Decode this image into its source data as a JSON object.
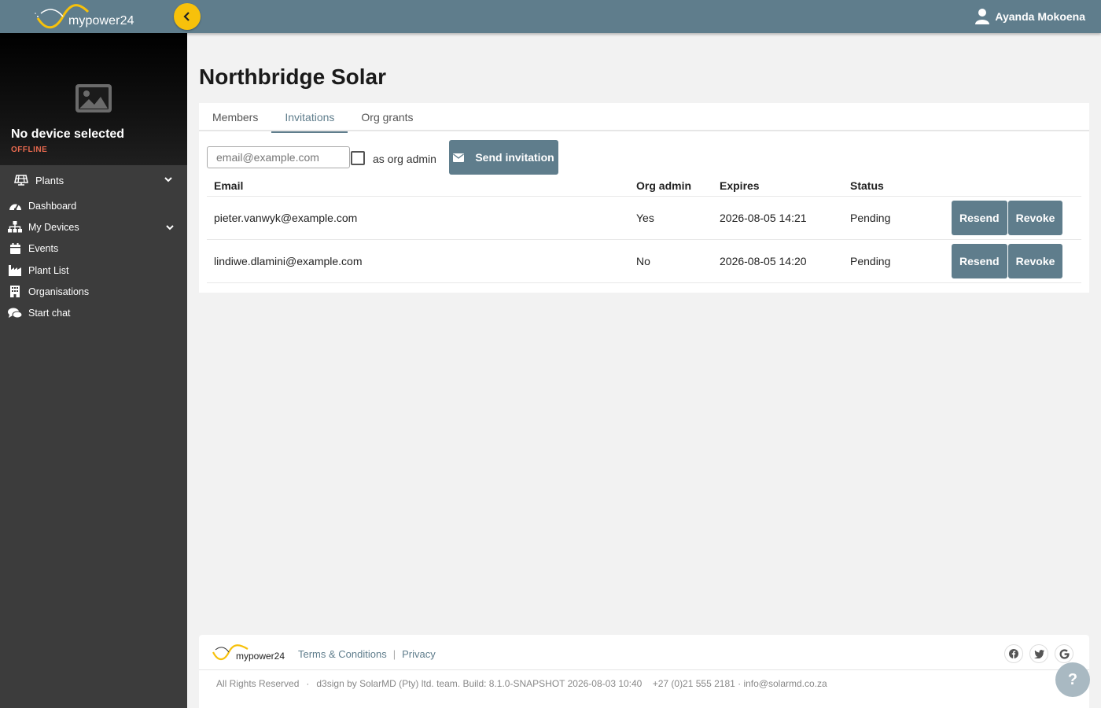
{
  "topbar": {
    "logo_text": "mypower24",
    "user_name": "Ayanda Mokoena"
  },
  "sidebar": {
    "device_title": "No device selected",
    "device_status": "OFFLINE",
    "plants_label": "Plants",
    "items": [
      {
        "label": "Dashboard",
        "icon": "dashboard-icon"
      },
      {
        "label": "My Devices",
        "icon": "sitemap-icon"
      },
      {
        "label": "Events",
        "icon": "calendar-icon"
      },
      {
        "label": "Plant List",
        "icon": "factory-icon"
      },
      {
        "label": "Organisations",
        "icon": "building-icon"
      },
      {
        "label": "Start chat",
        "icon": "chat-icon"
      }
    ]
  },
  "main": {
    "title": "Northbridge Solar",
    "tabs": [
      {
        "label": "Members"
      },
      {
        "label": "Invitations"
      },
      {
        "label": "Org grants"
      }
    ],
    "invite": {
      "email_placeholder": "email@example.com",
      "org_admin_label": "as org admin",
      "send_label": "Send invitation"
    },
    "table": {
      "headers": {
        "email": "Email",
        "org_admin": "Org admin",
        "expires": "Expires",
        "status": "Status"
      },
      "rows": [
        {
          "email": "pieter.vanwyk@example.com",
          "org_admin": "Yes",
          "expires": "2026-08-05 14:21",
          "status": "Pending"
        },
        {
          "email": "lindiwe.dlamini@example.com",
          "org_admin": "No",
          "expires": "2026-08-05 14:20",
          "status": "Pending"
        }
      ],
      "resend_label": "Resend",
      "revoke_label": "Revoke"
    }
  },
  "footer": {
    "logo_text": "mypower24",
    "terms": "Terms & Conditions",
    "privacy": "Privacy",
    "rights": "All Rights Reserved",
    "build": "d3sign by SolarMD (Pty) ltd. team. Build: 8.1.0-SNAPSHOT 2026-08-03 10:40",
    "contact": "+27 (0)21 555 2181 · info@solarmd.co.za"
  },
  "help_label": "?",
  "colors": {
    "accent": "#5f7d8c",
    "yellow": "#f7c10b",
    "offline": "#e86a4f"
  }
}
